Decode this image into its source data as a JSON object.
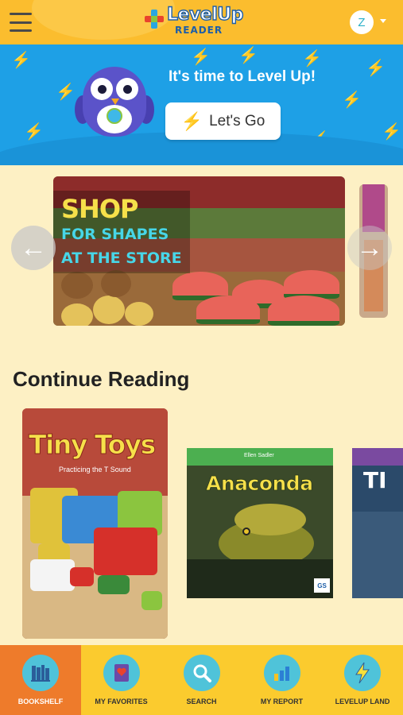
{
  "header": {
    "logo_line1": "LevelUp",
    "logo_line2": "READER",
    "avatar_initial": "Z"
  },
  "promo": {
    "headline": "It's time to Level Up!",
    "button_label": "Let's Go"
  },
  "carousel": {
    "slide_title_line1": "SHOP",
    "slide_title_line2": "FOR SHAPES",
    "slide_title_line3": "AT THE STORE"
  },
  "continue_reading": {
    "title": "Continue Reading",
    "books": [
      {
        "title": "Tiny Toys",
        "subtitle": "Practicing the T Sound"
      },
      {
        "title": "Anaconda",
        "author": "Ellen Sadler",
        "badge": "GS"
      },
      {
        "title": "TI"
      }
    ]
  },
  "nav": {
    "items": [
      {
        "label": "BOOKSHELF",
        "icon": "bookshelf-icon"
      },
      {
        "label": "MY FAVORITES",
        "icon": "heart-book-icon"
      },
      {
        "label": "SEARCH",
        "icon": "search-icon"
      },
      {
        "label": "MY REPORT",
        "icon": "bar-chart-icon"
      },
      {
        "label": "LEVELUP LAND",
        "icon": "lightning-icon"
      }
    ]
  },
  "colors": {
    "header_bg": "#fbbd2e",
    "promo_bg": "#1ea0e6",
    "page_bg": "#fdf0c4",
    "nav_bg": "#fbcb2e",
    "nav_active": "#ee7b2b",
    "nav_icon_bg": "#4fc3d9"
  }
}
